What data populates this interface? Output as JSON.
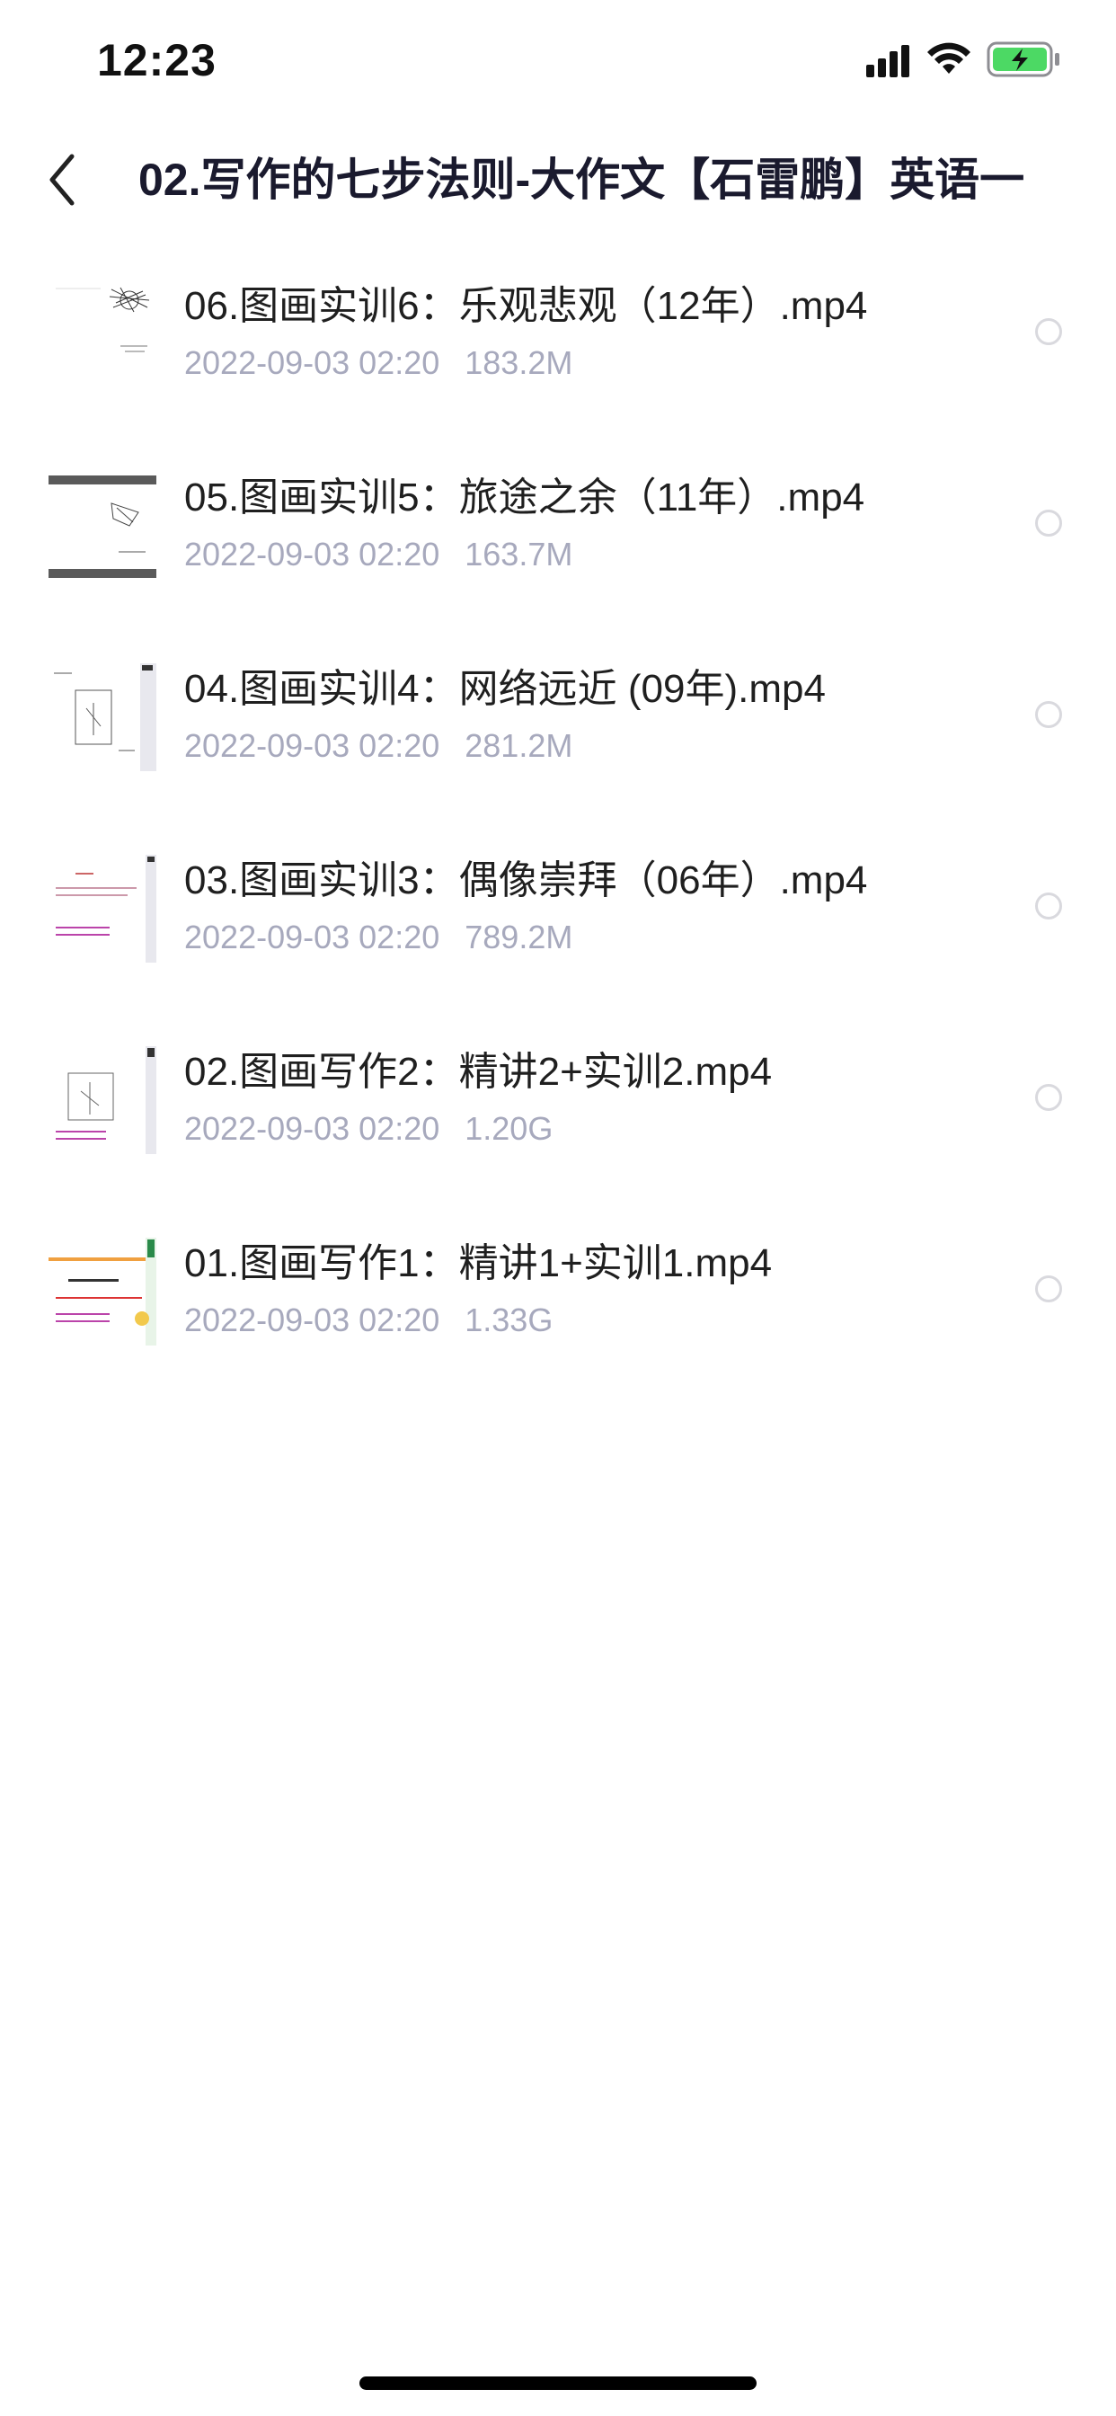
{
  "status_bar": {
    "time": "12:23",
    "signal_icon": "cellular-signal-icon",
    "wifi_icon": "wifi-icon",
    "battery_icon": "battery-charging-icon",
    "battery_color": "#4cd964"
  },
  "nav": {
    "back_icon": "chevron-left-icon",
    "title": "02.写作的七步法则-大作文【石雷鹏】英语一"
  },
  "files": [
    {
      "name": "06.图画实训6：乐观悲观（12年）.mp4",
      "date": "2022-09-03 02:20",
      "size": "183.2M",
      "thumb": "video-thumbnail"
    },
    {
      "name": "05.图画实训5：旅途之余（11年）.mp4",
      "date": "2022-09-03 02:20",
      "size": "163.7M",
      "thumb": "video-thumbnail"
    },
    {
      "name": "04.图画实训4：网络远近 (09年).mp4",
      "date": "2022-09-03 02:20",
      "size": "281.2M",
      "thumb": "video-thumbnail"
    },
    {
      "name": "03.图画实训3：偶像崇拜（06年）.mp4",
      "date": "2022-09-03 02:20",
      "size": "789.2M",
      "thumb": "video-thumbnail"
    },
    {
      "name": "02.图画写作2：精讲2+实训2.mp4",
      "date": "2022-09-03 02:20",
      "size": "1.20G",
      "thumb": "video-thumbnail"
    },
    {
      "name": "01.图画写作1：精讲1+实训1.mp4",
      "date": "2022-09-03 02:20",
      "size": "1.33G",
      "thumb": "video-thumbnail"
    }
  ],
  "colors": {
    "title": "#1a1a2e",
    "file_name": "#1f1f1f",
    "meta": "#a7a9bd",
    "radio_border": "#d9d9de"
  }
}
